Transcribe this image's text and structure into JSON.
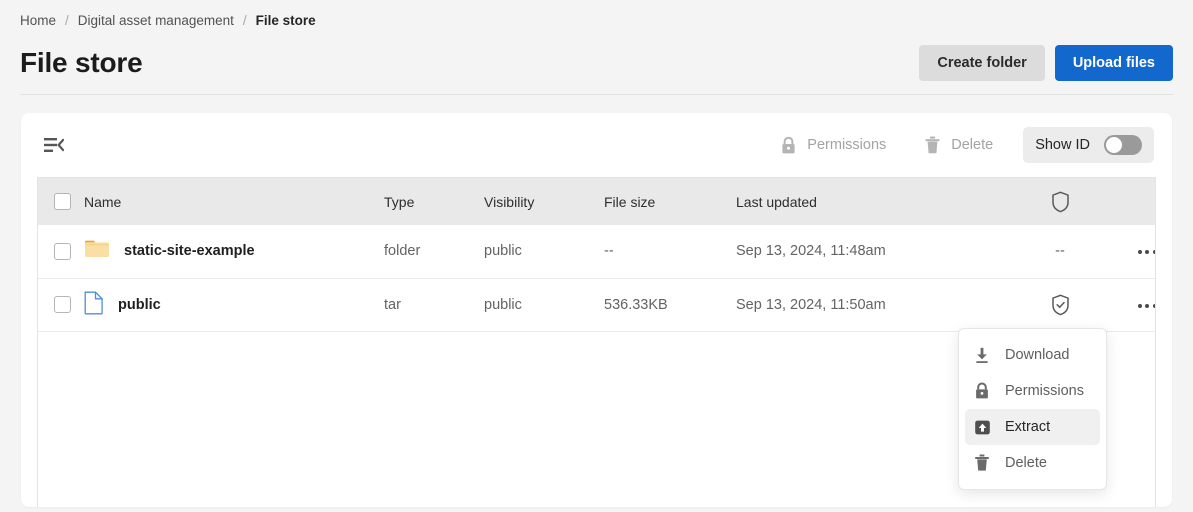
{
  "breadcrumb": {
    "items": [
      {
        "label": "Home",
        "current": false
      },
      {
        "label": "Digital asset management",
        "current": false
      },
      {
        "label": "File store",
        "current": true
      }
    ],
    "separator": "/"
  },
  "header": {
    "title": "File store",
    "create_folder_label": "Create folder",
    "upload_files_label": "Upload files"
  },
  "toolbar": {
    "panel_toggle_icon": "collapse-panel-icon",
    "permissions_label": "Permissions",
    "permissions_icon": "lock-icon",
    "delete_label": "Delete",
    "delete_icon": "trash-icon",
    "show_id_label": "Show ID",
    "show_id_enabled": false
  },
  "table": {
    "columns": [
      {
        "key": "check",
        "label": ""
      },
      {
        "key": "name",
        "label": "Name"
      },
      {
        "key": "type",
        "label": "Type"
      },
      {
        "key": "visibility",
        "label": "Visibility"
      },
      {
        "key": "size",
        "label": "File size"
      },
      {
        "key": "updated",
        "label": "Last updated"
      },
      {
        "key": "shield",
        "label": "",
        "icon": "shield-icon"
      },
      {
        "key": "menu",
        "label": ""
      }
    ],
    "rows": [
      {
        "icon": "folder-icon",
        "name": "static-site-example",
        "type": "folder",
        "visibility": "public",
        "size": "--",
        "updated": "Sep 13, 2024, 11:48am",
        "shield": "--",
        "menu_icon": "overflow-menu-icon"
      },
      {
        "icon": "file-icon",
        "name": "public",
        "type": "tar",
        "visibility": "public",
        "size": "536.33KB",
        "updated": "Sep 13, 2024, 11:50am",
        "shield": "shield-check-icon",
        "menu_icon": "overflow-menu-icon"
      }
    ]
  },
  "context_menu": {
    "items": [
      {
        "label": "Download",
        "icon": "download-icon",
        "active": false
      },
      {
        "label": "Permissions",
        "icon": "lock-icon",
        "active": false
      },
      {
        "label": "Extract",
        "icon": "extract-icon",
        "active": true
      },
      {
        "label": "Delete",
        "icon": "trash-icon",
        "active": false
      }
    ]
  },
  "colors": {
    "page_bg": "#f4f4f4",
    "primary": "#1368ce",
    "secondary": "#dcdcdc",
    "folder": "#f7d488",
    "file_outline": "#4d8ddb",
    "header_row": "#e9e9e9"
  }
}
